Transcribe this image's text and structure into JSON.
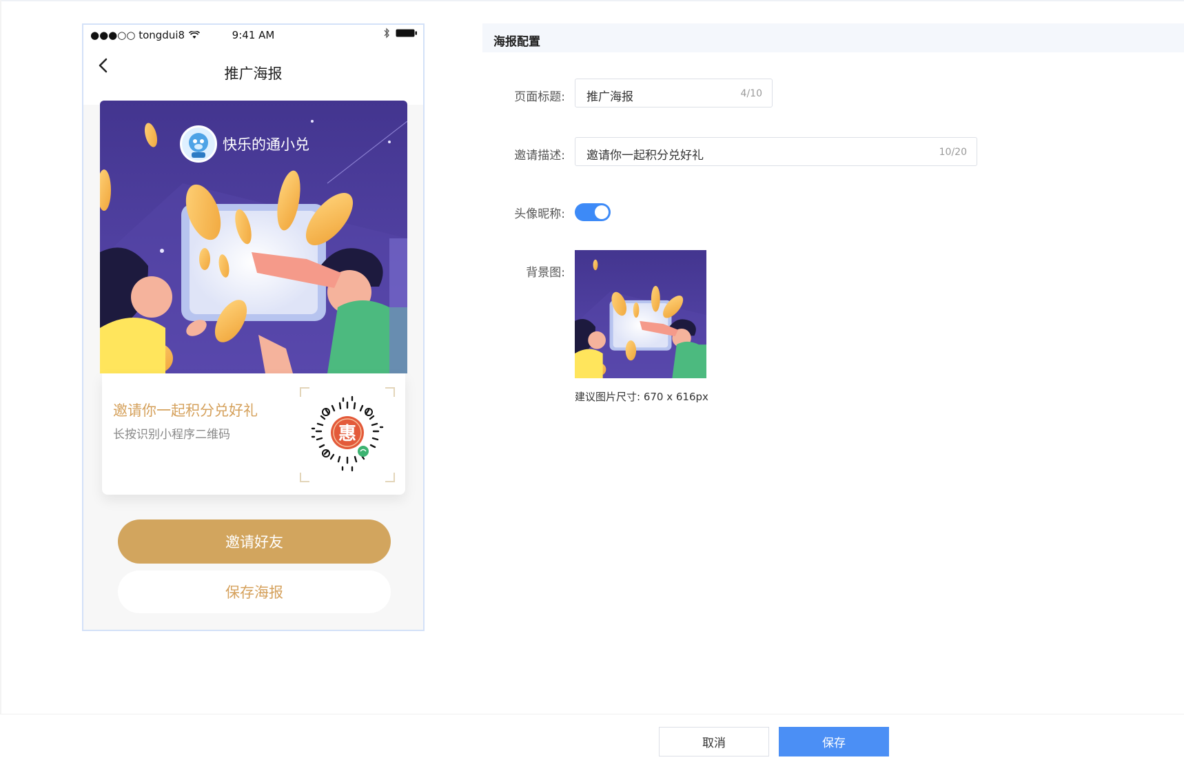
{
  "statusbar": {
    "carrier": "●●●○○ tongdui8",
    "time": "9:41 AM"
  },
  "nav": {
    "title": "推广海报"
  },
  "poster": {
    "nickname": "快乐的通小兑",
    "invite_text": "邀请你一起积分兑好礼",
    "qr_tip": "长按识别小程序二维码",
    "qr_center_char": "惠"
  },
  "actions": {
    "invite_label": "邀请好友",
    "save_poster_label": "保存海报"
  },
  "config": {
    "section_title": "海报配置",
    "page_title": {
      "label": "页面标题:",
      "value": "推广海报",
      "count": "4/10"
    },
    "invite_desc": {
      "label": "邀请描述:",
      "value": "邀请你一起积分兑好礼",
      "count": "10/20"
    },
    "avatar_nickname": {
      "label": "头像昵称:",
      "enabled": true
    },
    "background": {
      "label": "背景图:",
      "size_hint": "建议图片尺寸: 670 x 616px"
    }
  },
  "footer": {
    "cancel_label": "取消",
    "save_label": "保存"
  },
  "colors": {
    "accent_gold": "#d2a55e",
    "primary_blue": "#4b8ff5",
    "poster_purple": "#4a3a9c"
  }
}
